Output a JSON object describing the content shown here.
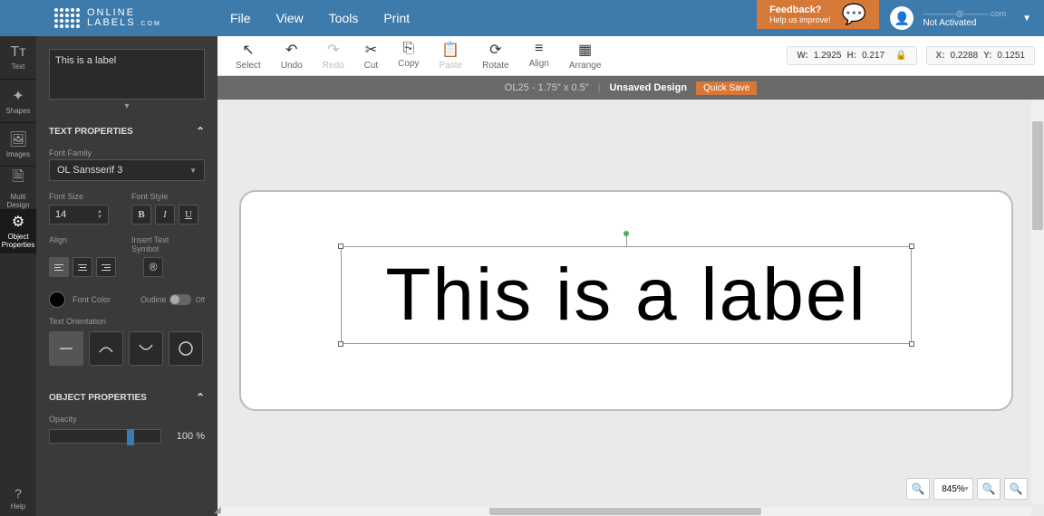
{
  "menu": {
    "file": "File",
    "view": "View",
    "tools": "Tools",
    "print": "Print"
  },
  "feedback": {
    "title": "Feedback?",
    "subtitle": "Help us improve!"
  },
  "user": {
    "email": "————@———.com",
    "status": "Not Activated"
  },
  "toolbar": {
    "select": "Select",
    "undo": "Undo",
    "redo": "Redo",
    "cut": "Cut",
    "copy": "Copy",
    "paste": "Paste",
    "rotate": "Rotate",
    "align": "Align",
    "arrange": "Arrange"
  },
  "coords": {
    "w_label": "W:",
    "w": "1.2925",
    "h_label": "H:",
    "h": "0.217",
    "x_label": "X:",
    "x": "0.2288",
    "y_label": "Y:",
    "y": "0.1251"
  },
  "status": {
    "template": "OL25 - 1.75\" x 0.5\"",
    "unsaved": "Unsaved Design",
    "save": "Quick Save"
  },
  "sidebar": {
    "text": "Text",
    "shapes": "Shapes",
    "images": "Images",
    "multi": "Multi\nDesign",
    "object": "Object\nProperties",
    "help": "Help"
  },
  "textValue": "This is a label",
  "sections": {
    "textprops": "TEXT PROPERTIES",
    "objprops": "OBJECT PROPERTIES"
  },
  "labels": {
    "fontfamily": "Font Family",
    "fontsize": "Font Size",
    "fontstyle": "Font Style",
    "align": "Align",
    "insertsymbol": "Insert Text Symbol",
    "fontcolor": "Font Color",
    "outline": "Outline",
    "outlineOff": "Off",
    "orientation": "Text Orientation",
    "opacity": "Opacity"
  },
  "font": {
    "family": "OL Sansserif 3",
    "size": "14"
  },
  "opacity": {
    "value": "100",
    "unit": "%"
  },
  "canvas": {
    "text": "This is a label"
  },
  "zoom": {
    "value": "845%"
  },
  "styleLetters": {
    "b": "B",
    "i": "I",
    "u": "U"
  }
}
